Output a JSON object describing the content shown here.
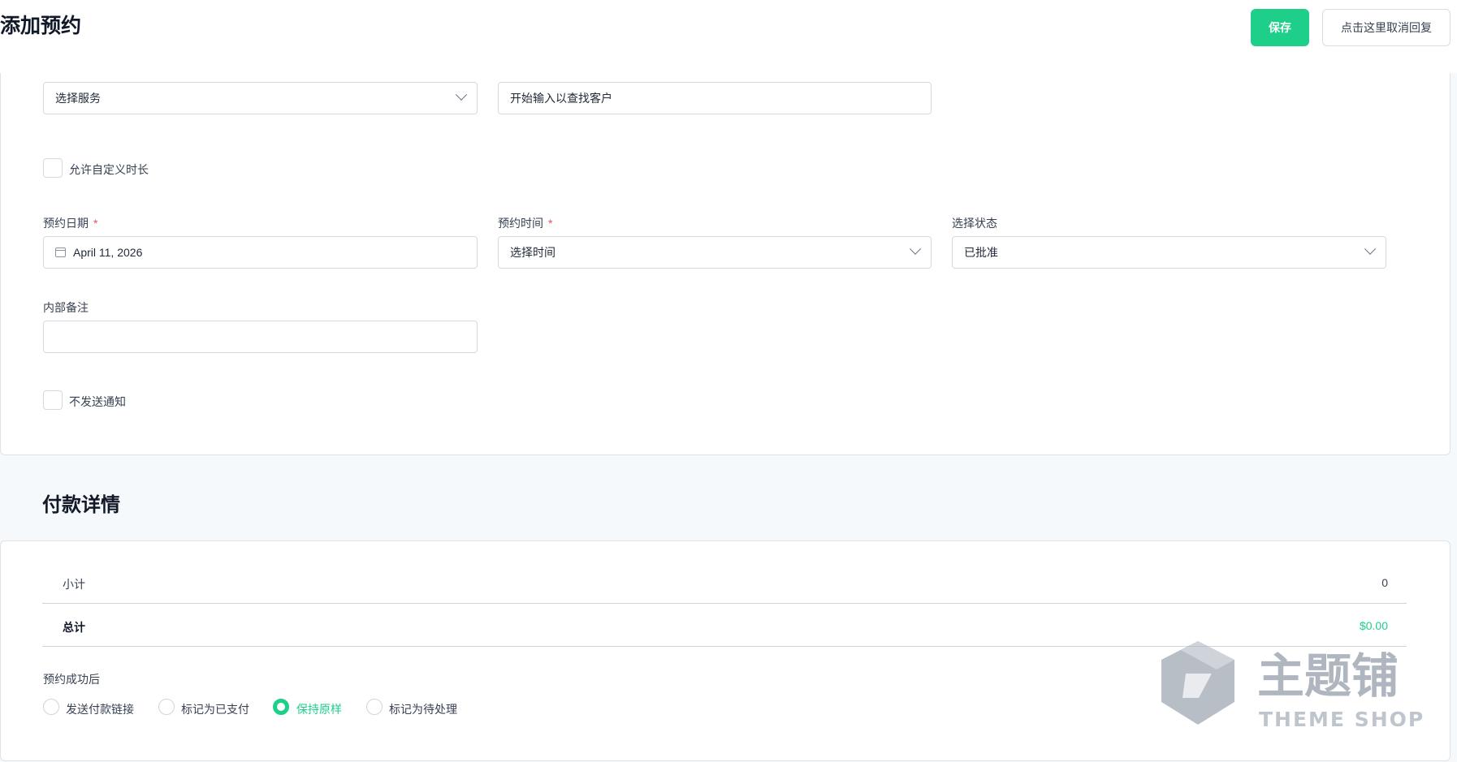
{
  "header": {
    "title": "添加预约",
    "save_label": "保存",
    "cancel_label": "点击这里取消回复"
  },
  "form": {
    "service_select": "选择服务",
    "customer_input_placeholder": "开始输入以查找客户",
    "custom_duration_label": "允许自定义时长",
    "date_label": "预约日期",
    "date_value": "April 11, 2026",
    "time_label": "预约时间",
    "time_select": "选择时间",
    "status_label": "选择状态",
    "status_select": "已批准",
    "notes_label": "内部备注",
    "notes_value": "",
    "no_notify_label": "不发送通知",
    "required_mark": "*"
  },
  "payment": {
    "title": "付款详情",
    "subtotal_label": "小计",
    "subtotal_value": "0",
    "total_label": "总计",
    "total_value": "$0.00",
    "after_label": "预约成功后",
    "options": [
      {
        "label": "发送付款链接",
        "selected": false
      },
      {
        "label": "标记为已支付",
        "selected": false
      },
      {
        "label": "保持原样",
        "selected": true
      },
      {
        "label": "标记为待处理",
        "selected": false
      }
    ]
  },
  "watermark": {
    "brand": "主题铺",
    "sub": "THEME SHOP"
  },
  "colors": {
    "accent": "#1ecf8a",
    "required": "#e8505b"
  }
}
